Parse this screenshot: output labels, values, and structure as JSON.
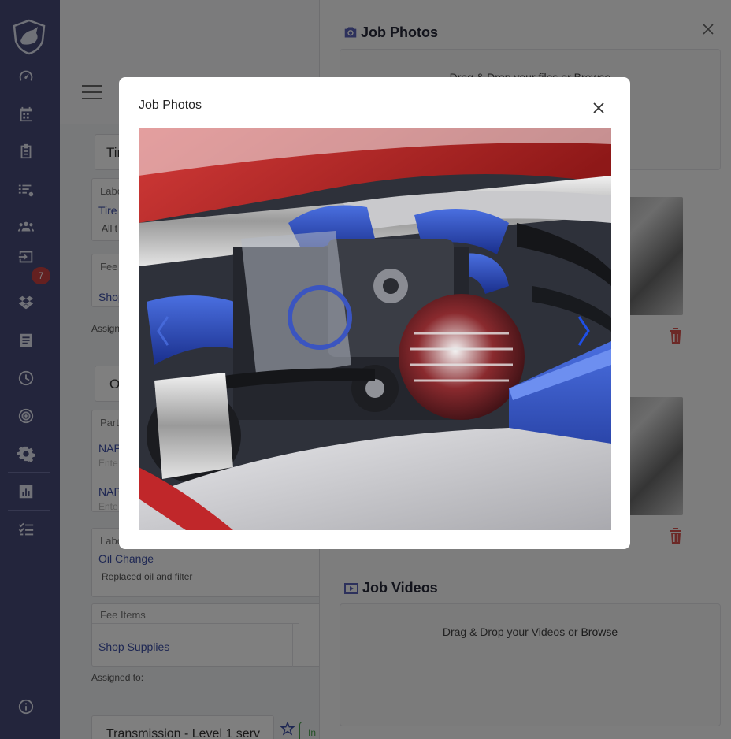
{
  "sidebar": {
    "badge_count": "7",
    "items": [
      {
        "icon": "dashboard-icon"
      },
      {
        "icon": "calendar-icon"
      },
      {
        "icon": "clipboard-icon"
      },
      {
        "icon": "task-list-icon"
      },
      {
        "icon": "customers-icon"
      },
      {
        "icon": "inbox-icon"
      },
      {
        "icon": "dropbox-icon"
      },
      {
        "icon": "document-icon"
      },
      {
        "icon": "clock-icon"
      },
      {
        "icon": "target-icon"
      },
      {
        "icon": "settings-icon"
      },
      {
        "icon": "report-icon"
      },
      {
        "icon": "checklist-icon"
      },
      {
        "icon": "info-icon"
      }
    ]
  },
  "left_panel": {
    "service1_title": "Tir",
    "labor_header1": "Labo",
    "labor_link1": "Tire",
    "labor_desc1": "All t",
    "fee_header1": "Fee",
    "fee_link1": "Shop",
    "assigned1": "Assigne",
    "service2_title": "O",
    "parts_header": "Part",
    "part_link1": "NAP",
    "part_hint1": "Ente",
    "part_link2": "NAP",
    "part_hint2": "Ente",
    "labor_header2": "Labo",
    "labor_link2": "Oil Change",
    "labor_desc2": "Replaced oil and filter",
    "fee_header2": "Fee Items",
    "fee_link2": "Shop Supplies",
    "assigned2": "Assigned to:",
    "service3_title": "Transmission - Level 1 serv",
    "status_chip": "In"
  },
  "right_panel": {
    "photos_title": "Job Photos",
    "photos_dropzone": "Drag & Drop your files or Browse",
    "videos_title": "Job Videos",
    "videos_dropzone_prefix": "Drag & Drop your Videos or ",
    "videos_browse": "Browse"
  },
  "modal": {
    "title": "Job Photos",
    "photo_subject": "car engine bay"
  },
  "colors": {
    "sidebar_bg": "#464a78",
    "badge": "#c94040",
    "link": "#3c4ea6",
    "trash": "#d9534f"
  }
}
